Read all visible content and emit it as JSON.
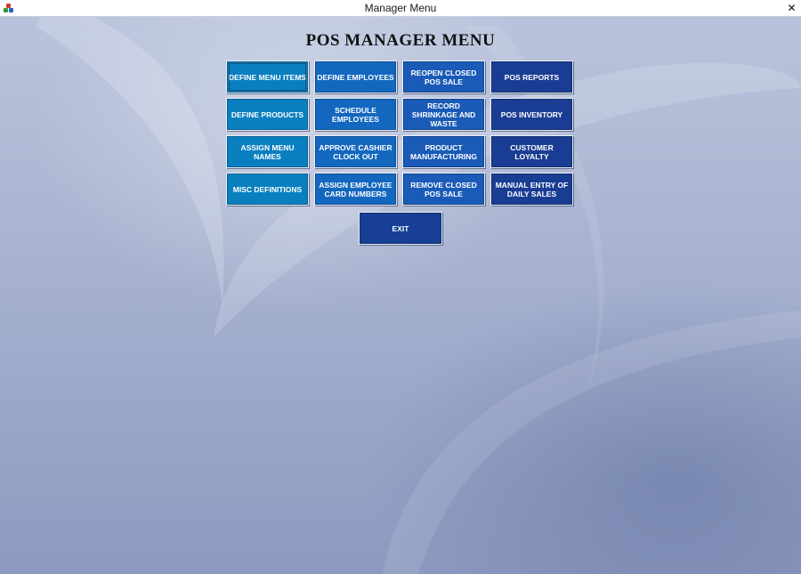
{
  "window": {
    "title": "Manager Menu",
    "close_glyph": "✕"
  },
  "page_title": "POS MANAGER  MENU",
  "buttons": [
    {
      "id": "define-menu-items",
      "label": "DEFINE MENU ITEMS"
    },
    {
      "id": "define-employees",
      "label": "DEFINE EMPLOYEES"
    },
    {
      "id": "reopen-closed-pos-sale",
      "label": "REOPEN CLOSED POS SALE"
    },
    {
      "id": "pos-reports",
      "label": "POS REPORTS"
    },
    {
      "id": "define-products",
      "label": "DEFINE PRODUCTS"
    },
    {
      "id": "schedule-employees",
      "label": "SCHEDULE EMPLOYEES"
    },
    {
      "id": "record-shrinkage-and-waste",
      "label": "RECORD SHRINKAGE AND WASTE"
    },
    {
      "id": "pos-inventory",
      "label": "POS INVENTORY"
    },
    {
      "id": "assign-menu-names",
      "label": "ASSIGN MENU NAMES"
    },
    {
      "id": "approve-cashier-clock-out",
      "label": "APPROVE CASHIER CLOCK OUT"
    },
    {
      "id": "product-manufacturing",
      "label": "PRODUCT MANUFACTURING"
    },
    {
      "id": "customer-loyalty",
      "label": "CUSTOMER LOYALTY"
    },
    {
      "id": "misc-definitions",
      "label": "MISC DEFINITIONS"
    },
    {
      "id": "assign-employee-card-numbers",
      "label": "ASSIGN EMPLOYEE CARD NUMBERS"
    },
    {
      "id": "remove-closed-pos-sale",
      "label": "REMOVE CLOSED POS SALE"
    },
    {
      "id": "manual-entry-of-daily-sales",
      "label": "MANUAL ENTRY OF DAILY SALES"
    }
  ],
  "exit_label": "EXIT",
  "colors": {
    "column_1": "#0a7fc0",
    "column_2": "#1367bf",
    "column_3": "#1a5bb7",
    "column_4": "#1a3d94",
    "exit": "#173f96"
  }
}
